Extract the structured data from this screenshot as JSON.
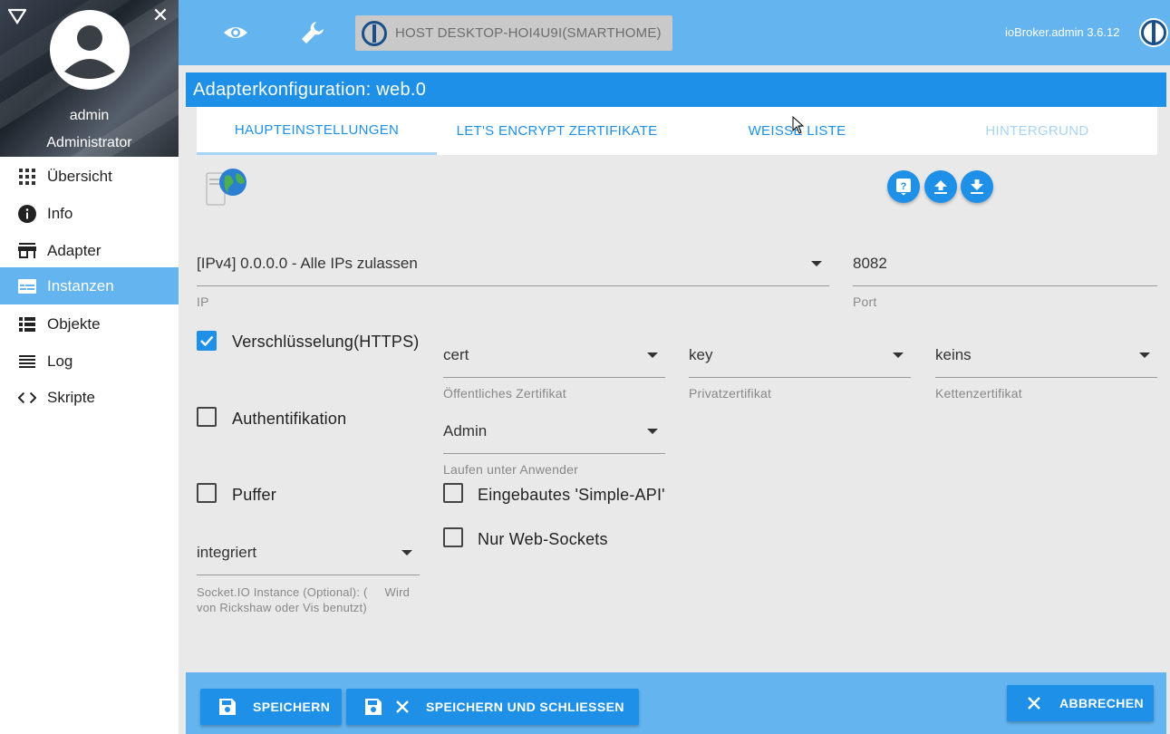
{
  "user": {
    "name": "admin",
    "role": "Administrator"
  },
  "nav": [
    {
      "label": "Übersicht",
      "icon": "grid-icon"
    },
    {
      "label": "Info",
      "icon": "info-icon"
    },
    {
      "label": "Adapter",
      "icon": "store-icon"
    },
    {
      "label": "Instanzen",
      "icon": "instances-icon",
      "active": true
    },
    {
      "label": "Objekte",
      "icon": "list-icon"
    },
    {
      "label": "Log",
      "icon": "log-icon"
    },
    {
      "label": "Skripte",
      "icon": "code-icon"
    }
  ],
  "topbar": {
    "host": "HOST DESKTOP-HOI4U9I(SMARTHOME)",
    "version": "ioBroker.admin 3.6.12"
  },
  "panel": {
    "title": "Adapterkonfiguration: web.0",
    "tabs": [
      "HAUPTEINSTELLUNGEN",
      "LET'S ENCRYPT ZERTIFIKATE",
      "WEISSE LISTE",
      "HINTERGRUND"
    ]
  },
  "form": {
    "ip": {
      "value": "[IPv4] 0.0.0.0 - Alle IPs zulassen",
      "label": "IP"
    },
    "port": {
      "value": "8082",
      "label": "Port"
    },
    "https": {
      "label": "Verschlüsselung(HTTPS)",
      "checked": true
    },
    "auth": {
      "label": "Authentifikation",
      "checked": false
    },
    "cache": {
      "label": "Puffer",
      "checked": false
    },
    "cert": {
      "value": "cert",
      "label": "Öffentliches Zertifikat"
    },
    "key": {
      "value": "key",
      "label": "Privatzertifikat"
    },
    "chain": {
      "value": "keins",
      "label": "Kettenzertifikat"
    },
    "defaultUser": {
      "value": "Admin",
      "label": "Laufen unter Anwender"
    },
    "simpleApi": {
      "label": "Eingebautes 'Simple-API'",
      "checked": false
    },
    "webSockets": {
      "label": "Nur Web-Sockets",
      "checked": false
    },
    "socketio": {
      "value": "integriert",
      "label_line1": "Socket.IO Instance (Optional): (     Wird",
      "label_line2": "von Rickshaw oder Vis benutzt)"
    }
  },
  "buttons": {
    "save": "SPEICHERN",
    "save_close": "SPEICHERN UND SCHLIESSEN",
    "cancel": "ABBRECHEN"
  },
  "colors": {
    "primary": "#1e90e8",
    "light": "#64b4f0",
    "sidebar_active": "#64b4f0"
  }
}
